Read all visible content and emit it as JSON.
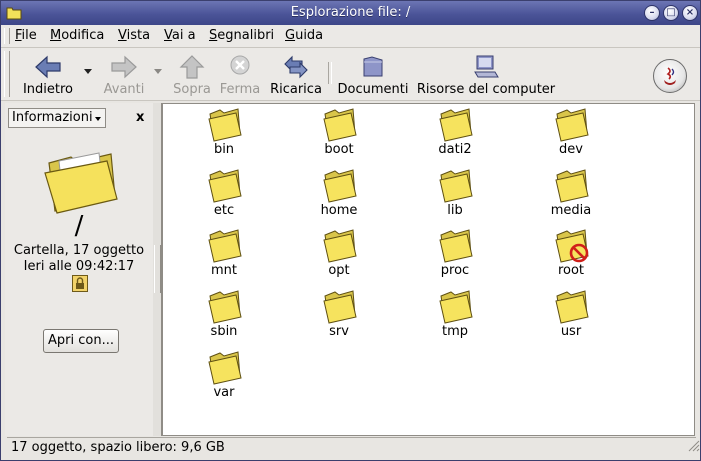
{
  "window": {
    "title": "Esplorazione file: /"
  },
  "menubar": {
    "items": [
      {
        "label": "File",
        "ul": "F",
        "rest": "ile"
      },
      {
        "label": "Modifica",
        "ul": "M",
        "rest": "odifica"
      },
      {
        "label": "Vista",
        "ul": "V",
        "rest": "ista"
      },
      {
        "label": "Vai a",
        "ul": "V",
        "rest": "ai a"
      },
      {
        "label": "Segnalibri",
        "ul": "S",
        "rest": "egnalibri"
      },
      {
        "label": "Guida",
        "ul": "G",
        "rest": "uida"
      }
    ]
  },
  "toolbar": {
    "back": "Indietro",
    "forward": "Avanti",
    "up": "Sopra",
    "stop": "Ferma",
    "reload": "Ricarica",
    "documents": "Documenti",
    "computer": "Risorse del computer"
  },
  "sidepane": {
    "selector": "Informazioni",
    "close": "x",
    "path": "/",
    "summary": "Cartella, 17 oggetto",
    "modified": "Ieri alle 09:42:17",
    "open_with": "Apri con..."
  },
  "files": [
    {
      "name": "bin"
    },
    {
      "name": "boot"
    },
    {
      "name": "dati2"
    },
    {
      "name": "dev"
    },
    {
      "name": "etc"
    },
    {
      "name": "home"
    },
    {
      "name": "lib"
    },
    {
      "name": "media"
    },
    {
      "name": "mnt"
    },
    {
      "name": "opt"
    },
    {
      "name": "proc"
    },
    {
      "name": "root"
    },
    {
      "name": "sbin"
    },
    {
      "name": "srv"
    },
    {
      "name": "tmp"
    },
    {
      "name": "usr"
    },
    {
      "name": "var"
    }
  ],
  "statusbar": {
    "text": "17 oggetto, spazio libero: 9,6 GB"
  },
  "colors": {
    "titlebar": "#4b5498",
    "folder": "#f3e05a",
    "background": "#ebe9e6"
  }
}
